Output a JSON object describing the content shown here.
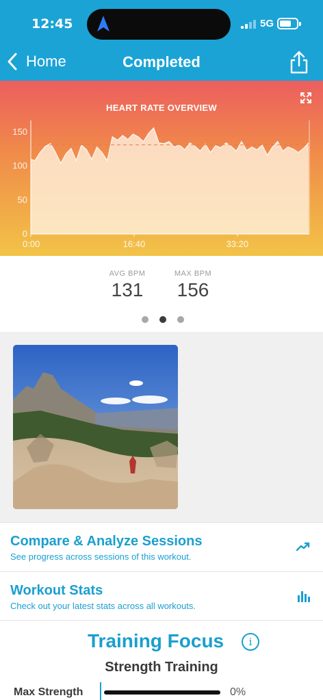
{
  "status_bar": {
    "time": "12:45",
    "network": "5G",
    "icons": [
      "location-arrow-icon",
      "signal-icon",
      "battery-icon"
    ]
  },
  "nav": {
    "back_label": "Home",
    "title": "Completed",
    "icons": [
      "chevron-left-icon",
      "share-icon"
    ]
  },
  "colors": {
    "brand_blue": "#1ba3d6",
    "accent_text": "#1a9fcf",
    "chart_top": "#ec5e5e",
    "chart_bottom": "#f2c347"
  },
  "heart_rate_chart": {
    "title": "HEART RATE OVERVIEW",
    "expand_icon": "expand-icon"
  },
  "chart_data": {
    "type": "area",
    "title": "HEART RATE OVERVIEW",
    "xlabel": "",
    "ylabel": "",
    "x_ticks": [
      "0:00",
      "16:40",
      "33:20"
    ],
    "y_ticks": [
      0,
      50,
      100,
      150
    ],
    "ylim": [
      0,
      165
    ],
    "xlim": [
      0,
      2690
    ],
    "grid": false,
    "reference_line": {
      "y": 131
    },
    "series": [
      {
        "x": [
          0,
          40,
          90,
          140,
          190,
          240,
          290,
          340,
          390,
          440,
          490,
          540,
          590,
          640,
          690,
          740,
          790,
          840,
          890,
          940,
          990,
          1040,
          1090,
          1140,
          1190,
          1240,
          1290,
          1340,
          1390,
          1440,
          1490,
          1540,
          1590,
          1640,
          1690,
          1740,
          1790,
          1840,
          1890,
          1940,
          1990,
          2040,
          2090,
          2140,
          2190,
          2240,
          2290,
          2340,
          2390,
          2440,
          2490,
          2540,
          2590,
          2640,
          2690
        ],
        "values": [
          110,
          108,
          120,
          129,
          133,
          120,
          104,
          118,
          126,
          108,
          131,
          124,
          110,
          128,
          120,
          108,
          143,
          138,
          145,
          139,
          147,
          143,
          136,
          148,
          156,
          134,
          133,
          136,
          128,
          131,
          124,
          134,
          129,
          122,
          132,
          120,
          130,
          127,
          134,
          129,
          122,
          136,
          123,
          128,
          124,
          131,
          116,
          128,
          136,
          122,
          128,
          125,
          120,
          126,
          134
        ]
      }
    ]
  },
  "stats": {
    "avg_label": "AVG BPM",
    "avg_value": "131",
    "max_label": "MAX BPM",
    "max_value": "156",
    "page_indicator": {
      "count": 3,
      "active": 2
    }
  },
  "photo": {
    "subject": "mountain-trail-photo"
  },
  "compare": {
    "title": "Compare & Analyze Sessions",
    "subtitle": "See progress across sessions of this workout.",
    "icon": "trend-up-icon"
  },
  "workout_stats": {
    "title": "Workout Stats",
    "subtitle": "Check out your latest stats across all workouts.",
    "icon": "bar-chart-icon"
  },
  "training_focus": {
    "title": "Training Focus",
    "info_icon": "info-icon",
    "subtitle": "Strength Training",
    "bars": [
      {
        "label": "Max Strength",
        "percent_text": "0%",
        "fraction": 0.0
      }
    ]
  }
}
